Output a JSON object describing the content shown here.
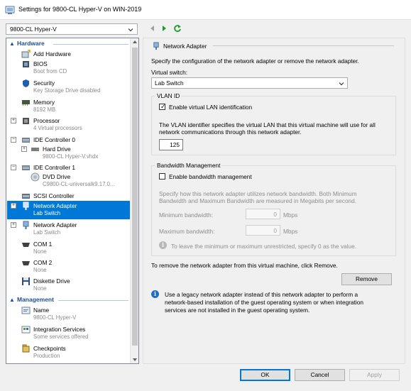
{
  "window": {
    "title": "Settings for 9800-CL Hyper-V on WIN-2019"
  },
  "vm_selector": {
    "value": "9800-CL Hyper-V"
  },
  "icons": {
    "back": "back-arrow-icon",
    "forward": "play-forward-icon",
    "refresh": "refresh-icon"
  },
  "tree": {
    "hardware_label": "Hardware",
    "management_label": "Management",
    "items": [
      {
        "label": "Add Hardware",
        "sub": ""
      },
      {
        "label": "BIOS",
        "sub": "Boot from CD"
      },
      {
        "label": "Security",
        "sub": "Key Storage Drive disabled"
      },
      {
        "label": "Memory",
        "sub": "8192 MB"
      },
      {
        "label": "Processor",
        "sub": "4 Virtual processors"
      },
      {
        "label": "IDE Controller 0",
        "sub": ""
      },
      {
        "label": "Hard Drive",
        "sub": "9800-CL Hyper-V.vhdx"
      },
      {
        "label": "IDE Controller 1",
        "sub": ""
      },
      {
        "label": "DVD Drive",
        "sub": "C9800-CL-universalk9.17.0..."
      },
      {
        "label": "SCSI Controller",
        "sub": ""
      },
      {
        "label": "Network Adapter",
        "sub": "Lab Switch"
      },
      {
        "label": "Network Adapter",
        "sub": "Lab Switch"
      },
      {
        "label": "COM 1",
        "sub": "None"
      },
      {
        "label": "COM 2",
        "sub": "None"
      },
      {
        "label": "Diskette Drive",
        "sub": "None"
      },
      {
        "label": "Name",
        "sub": "9800-CL Hyper-V"
      },
      {
        "label": "Integration Services",
        "sub": "Some services offered"
      },
      {
        "label": "Checkpoints",
        "sub": "Production"
      }
    ]
  },
  "panel": {
    "header": "Network Adapter",
    "description": "Specify the configuration of the network adapter or remove the network adapter.",
    "virtual_switch_label": "Virtual switch:",
    "virtual_switch_value": "Lab Switch",
    "vlan": {
      "group_label": "VLAN ID",
      "checkbox_label": "Enable virtual LAN identification",
      "checked": true,
      "help_line1": "The VLAN identifier specifies the virtual LAN that this virtual machine will use for all",
      "help_line2": "network communications through this network adapter.",
      "value": "125"
    },
    "bandwidth": {
      "group_label": "Bandwidth Management",
      "checkbox_label": "Enable bandwidth management",
      "checked": false,
      "help_line1": "Specify how this network adapter utilizes network bandwidth. Both Minimum",
      "help_line2": "Bandwidth and Maximum Bandwidth are measured in Megabits per second.",
      "min_label": "Minimum bandwidth:",
      "min_value": "0",
      "max_label": "Maximum bandwidth:",
      "max_value": "0",
      "unit": "Mbps",
      "note": "To leave the minimum or maximum unrestricted, specify 0 as the value."
    },
    "remove_text": "To remove the network adapter from this virtual machine, click Remove.",
    "remove_button": "Remove",
    "legacy_line1": "Use a legacy network adapter instead of this network adapter to perform a",
    "legacy_line2": "network-based installation of the guest operating system or when integration",
    "legacy_line3": "services are not installed in the guest operating system."
  },
  "footer": {
    "ok": "OK",
    "cancel": "Cancel",
    "apply": "Apply"
  },
  "colors": {
    "selection": "#0078d7",
    "section_head": "#1d4f8c"
  }
}
